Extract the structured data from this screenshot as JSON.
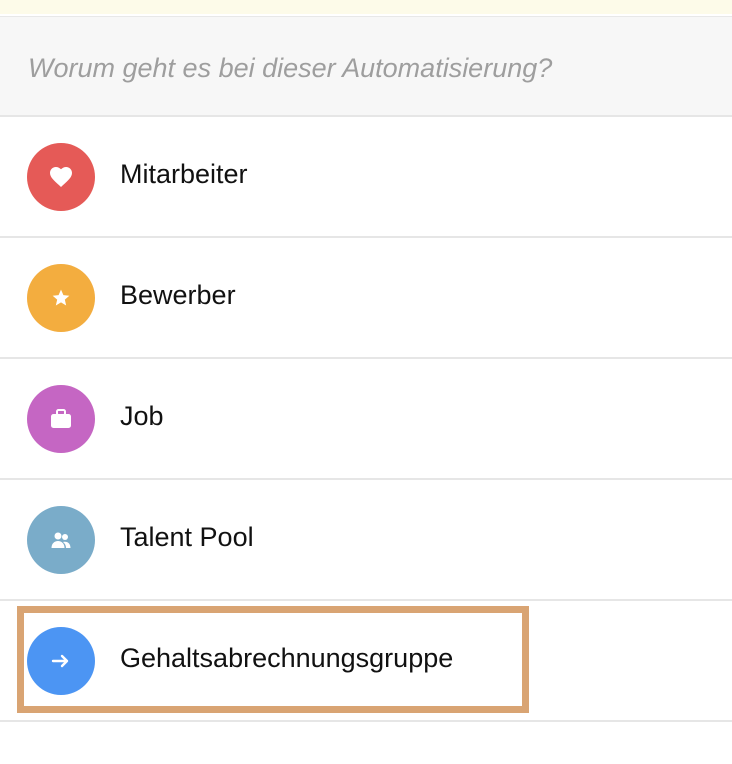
{
  "search": {
    "placeholder": "Worum geht es bei dieser Automatisierung?"
  },
  "categories": [
    {
      "label": "Mitarbeiter",
      "icon": "heart-icon",
      "color": "#e55a57"
    },
    {
      "label": "Bewerber",
      "icon": "star-icon",
      "color": "#f3ad3f"
    },
    {
      "label": "Job",
      "icon": "briefcase-icon",
      "color": "#c566c3"
    },
    {
      "label": "Talent Pool",
      "icon": "people-icon",
      "color": "#7aacc9"
    },
    {
      "label": "Gehaltsabrechnungsgruppe",
      "icon": "arrow-right-icon",
      "color": "#4c95f3"
    }
  ],
  "highlight": {
    "selected_item": "Gehaltsabrechnungsgruppe",
    "color": "#d9a473"
  }
}
